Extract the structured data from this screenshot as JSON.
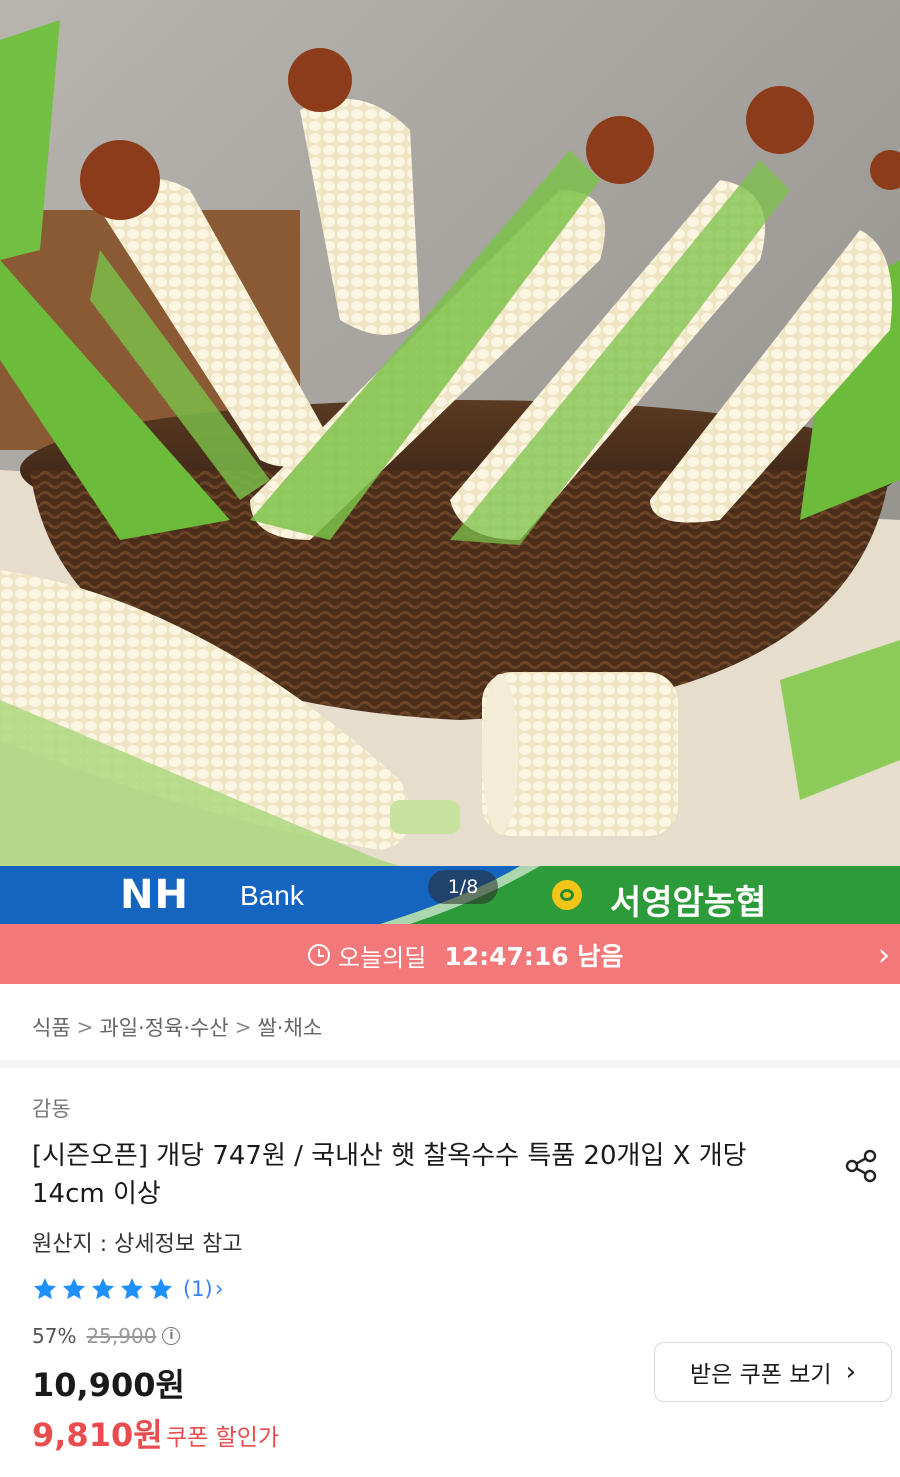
{
  "banner": {
    "bank_logo": "NH",
    "bank_name": "Bank",
    "pager": "1/8",
    "coop_name": "서영암농협"
  },
  "deal": {
    "label": "오늘의딜",
    "time": "12:47:16 남음",
    "chevron": "›"
  },
  "breadcrumb": {
    "items": [
      "식품",
      "과일·정육·수산",
      "쌀·채소"
    ],
    "separator": ">"
  },
  "product": {
    "brand": "감동",
    "title": "[시즌오픈] 개당 747원 / 국내산 햇 찰옥수수 특품 20개입 X 개당 14cm 이상",
    "origin": "원산지 : 상세정보 참고",
    "rating": 5,
    "rating_count": "(1)",
    "discount": "57%",
    "original_price": "25,900",
    "price": "10,900원",
    "coupon_price": "9,810원",
    "coupon_label": "쿠폰 할인가",
    "coupon_button": "받은 쿠폰 보기"
  },
  "colors": {
    "deal_bar": "#f27879",
    "nh_blue": "#1565c0",
    "coop_green": "#2e9b3a",
    "star_blue": "#1e90ff",
    "coupon_red": "#e84c4c"
  },
  "icons": {
    "share": "share-icon",
    "clock": "clock-icon",
    "info": "info-icon",
    "star": "star-icon"
  }
}
